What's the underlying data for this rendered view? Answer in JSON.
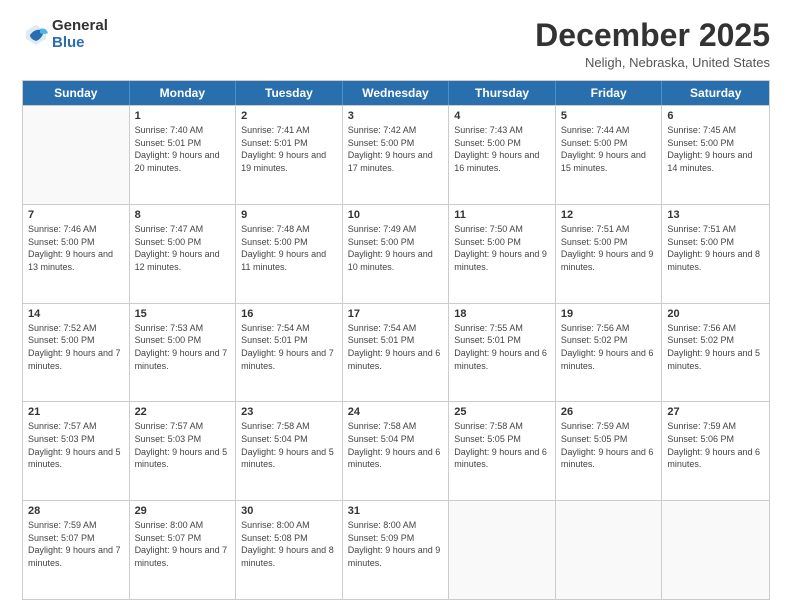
{
  "logo": {
    "general": "General",
    "blue": "Blue"
  },
  "header": {
    "month": "December 2025",
    "location": "Neligh, Nebraska, United States"
  },
  "days": [
    "Sunday",
    "Monday",
    "Tuesday",
    "Wednesday",
    "Thursday",
    "Friday",
    "Saturday"
  ],
  "rows": [
    [
      {
        "day": "",
        "empty": true
      },
      {
        "day": "1",
        "sunrise": "Sunrise: 7:40 AM",
        "sunset": "Sunset: 5:01 PM",
        "daylight": "Daylight: 9 hours and 20 minutes."
      },
      {
        "day": "2",
        "sunrise": "Sunrise: 7:41 AM",
        "sunset": "Sunset: 5:01 PM",
        "daylight": "Daylight: 9 hours and 19 minutes."
      },
      {
        "day": "3",
        "sunrise": "Sunrise: 7:42 AM",
        "sunset": "Sunset: 5:00 PM",
        "daylight": "Daylight: 9 hours and 17 minutes."
      },
      {
        "day": "4",
        "sunrise": "Sunrise: 7:43 AM",
        "sunset": "Sunset: 5:00 PM",
        "daylight": "Daylight: 9 hours and 16 minutes."
      },
      {
        "day": "5",
        "sunrise": "Sunrise: 7:44 AM",
        "sunset": "Sunset: 5:00 PM",
        "daylight": "Daylight: 9 hours and 15 minutes."
      },
      {
        "day": "6",
        "sunrise": "Sunrise: 7:45 AM",
        "sunset": "Sunset: 5:00 PM",
        "daylight": "Daylight: 9 hours and 14 minutes."
      }
    ],
    [
      {
        "day": "7",
        "sunrise": "Sunrise: 7:46 AM",
        "sunset": "Sunset: 5:00 PM",
        "daylight": "Daylight: 9 hours and 13 minutes."
      },
      {
        "day": "8",
        "sunrise": "Sunrise: 7:47 AM",
        "sunset": "Sunset: 5:00 PM",
        "daylight": "Daylight: 9 hours and 12 minutes."
      },
      {
        "day": "9",
        "sunrise": "Sunrise: 7:48 AM",
        "sunset": "Sunset: 5:00 PM",
        "daylight": "Daylight: 9 hours and 11 minutes."
      },
      {
        "day": "10",
        "sunrise": "Sunrise: 7:49 AM",
        "sunset": "Sunset: 5:00 PM",
        "daylight": "Daylight: 9 hours and 10 minutes."
      },
      {
        "day": "11",
        "sunrise": "Sunrise: 7:50 AM",
        "sunset": "Sunset: 5:00 PM",
        "daylight": "Daylight: 9 hours and 9 minutes."
      },
      {
        "day": "12",
        "sunrise": "Sunrise: 7:51 AM",
        "sunset": "Sunset: 5:00 PM",
        "daylight": "Daylight: 9 hours and 9 minutes."
      },
      {
        "day": "13",
        "sunrise": "Sunrise: 7:51 AM",
        "sunset": "Sunset: 5:00 PM",
        "daylight": "Daylight: 9 hours and 8 minutes."
      }
    ],
    [
      {
        "day": "14",
        "sunrise": "Sunrise: 7:52 AM",
        "sunset": "Sunset: 5:00 PM",
        "daylight": "Daylight: 9 hours and 7 minutes."
      },
      {
        "day": "15",
        "sunrise": "Sunrise: 7:53 AM",
        "sunset": "Sunset: 5:00 PM",
        "daylight": "Daylight: 9 hours and 7 minutes."
      },
      {
        "day": "16",
        "sunrise": "Sunrise: 7:54 AM",
        "sunset": "Sunset: 5:01 PM",
        "daylight": "Daylight: 9 hours and 7 minutes."
      },
      {
        "day": "17",
        "sunrise": "Sunrise: 7:54 AM",
        "sunset": "Sunset: 5:01 PM",
        "daylight": "Daylight: 9 hours and 6 minutes."
      },
      {
        "day": "18",
        "sunrise": "Sunrise: 7:55 AM",
        "sunset": "Sunset: 5:01 PM",
        "daylight": "Daylight: 9 hours and 6 minutes."
      },
      {
        "day": "19",
        "sunrise": "Sunrise: 7:56 AM",
        "sunset": "Sunset: 5:02 PM",
        "daylight": "Daylight: 9 hours and 6 minutes."
      },
      {
        "day": "20",
        "sunrise": "Sunrise: 7:56 AM",
        "sunset": "Sunset: 5:02 PM",
        "daylight": "Daylight: 9 hours and 5 minutes."
      }
    ],
    [
      {
        "day": "21",
        "sunrise": "Sunrise: 7:57 AM",
        "sunset": "Sunset: 5:03 PM",
        "daylight": "Daylight: 9 hours and 5 minutes."
      },
      {
        "day": "22",
        "sunrise": "Sunrise: 7:57 AM",
        "sunset": "Sunset: 5:03 PM",
        "daylight": "Daylight: 9 hours and 5 minutes."
      },
      {
        "day": "23",
        "sunrise": "Sunrise: 7:58 AM",
        "sunset": "Sunset: 5:04 PM",
        "daylight": "Daylight: 9 hours and 5 minutes."
      },
      {
        "day": "24",
        "sunrise": "Sunrise: 7:58 AM",
        "sunset": "Sunset: 5:04 PM",
        "daylight": "Daylight: 9 hours and 6 minutes."
      },
      {
        "day": "25",
        "sunrise": "Sunrise: 7:58 AM",
        "sunset": "Sunset: 5:05 PM",
        "daylight": "Daylight: 9 hours and 6 minutes."
      },
      {
        "day": "26",
        "sunrise": "Sunrise: 7:59 AM",
        "sunset": "Sunset: 5:05 PM",
        "daylight": "Daylight: 9 hours and 6 minutes."
      },
      {
        "day": "27",
        "sunrise": "Sunrise: 7:59 AM",
        "sunset": "Sunset: 5:06 PM",
        "daylight": "Daylight: 9 hours and 6 minutes."
      }
    ],
    [
      {
        "day": "28",
        "sunrise": "Sunrise: 7:59 AM",
        "sunset": "Sunset: 5:07 PM",
        "daylight": "Daylight: 9 hours and 7 minutes."
      },
      {
        "day": "29",
        "sunrise": "Sunrise: 8:00 AM",
        "sunset": "Sunset: 5:07 PM",
        "daylight": "Daylight: 9 hours and 7 minutes."
      },
      {
        "day": "30",
        "sunrise": "Sunrise: 8:00 AM",
        "sunset": "Sunset: 5:08 PM",
        "daylight": "Daylight: 9 hours and 8 minutes."
      },
      {
        "day": "31",
        "sunrise": "Sunrise: 8:00 AM",
        "sunset": "Sunset: 5:09 PM",
        "daylight": "Daylight: 9 hours and 9 minutes."
      },
      {
        "day": "",
        "empty": true
      },
      {
        "day": "",
        "empty": true
      },
      {
        "day": "",
        "empty": true
      }
    ]
  ]
}
